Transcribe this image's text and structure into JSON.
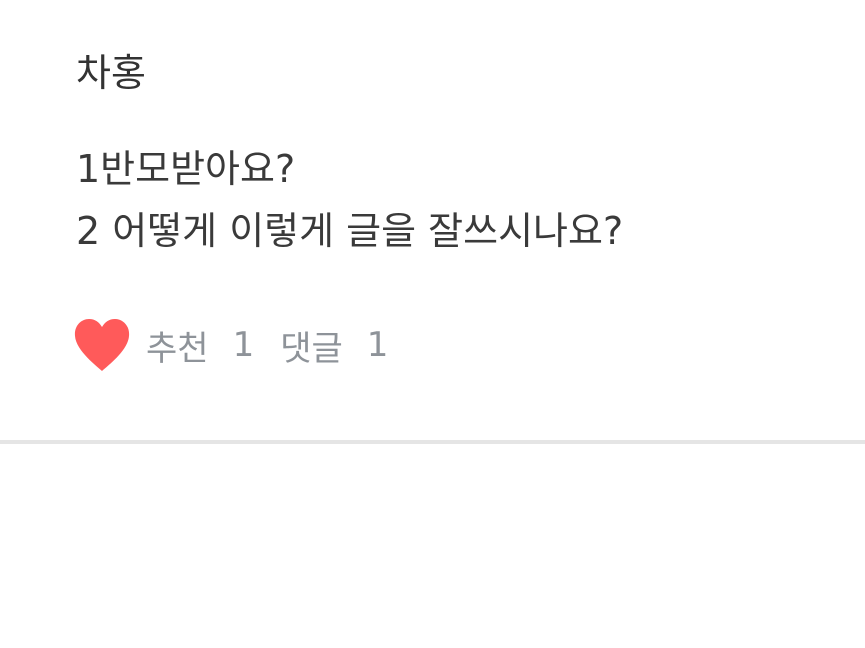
{
  "comment": {
    "author": "차홍",
    "lines": [
      "1반모받아요?",
      "2 어떻게 이렇게 글을 잘쓰시나요?"
    ],
    "recommend_label": "추천",
    "recommend_count": "1",
    "reply_label": "댓글",
    "reply_count": "1"
  },
  "icons": {
    "like": "heart-icon"
  },
  "colors": {
    "heart": "#ff5a5a",
    "text": "#333333",
    "meta_text": "#8e9399",
    "divider": "#e5e5e5"
  }
}
